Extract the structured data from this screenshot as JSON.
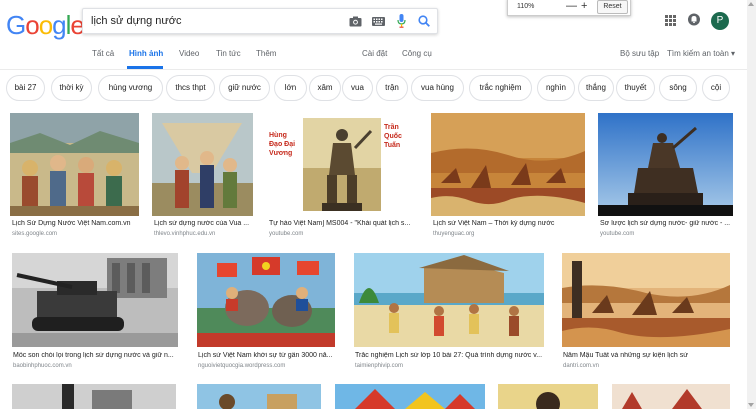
{
  "search": {
    "query": "lịch sử dựng nước"
  },
  "logo": {
    "letters": [
      "G",
      "o",
      "o",
      "g",
      "l",
      "e"
    ],
    "colors": [
      "#4285f4",
      "#ea4335",
      "#fbbc05",
      "#4285f4",
      "#34a853",
      "#ea4335"
    ]
  },
  "zoom": {
    "level": "110%",
    "minus": "—",
    "plus": "+",
    "reset": "Reset"
  },
  "account": {
    "initial": "P",
    "avatar_color": "#1c6a4e"
  },
  "tabs": {
    "all": "Tất cả",
    "images": "Hình ảnh",
    "videos": "Video",
    "news": "Tin tức",
    "more": "Thêm",
    "settings": "Cài đặt",
    "tools": "Công cụ",
    "collections": "Bộ sưu tập",
    "safe_search": "Tìm kiếm an toàn ▾"
  },
  "chips": [
    "bài 27",
    "thời kỳ",
    "hùng vương",
    "thcs thpt",
    "giữ nước",
    "lớn",
    "xâm",
    "vua",
    "trận",
    "vua hùng",
    "trắc nghiệm",
    "nghìn",
    "thắng",
    "thuyết",
    "sông",
    "cội"
  ],
  "results": [
    {
      "title": "Lịch Sử Dựng Nước Việt Nam.com.vn",
      "source": "sites.google.com"
    },
    {
      "title": "Lịch sử dựng nước của Vua ...",
      "source": "thlevo.vinhphuc.edu.vn"
    },
    {
      "title": "Tự hào Việt Nam] MS004 - \"Khái quát lịch s...",
      "source": "youtube.com",
      "poster_left": "Hùng Đạo Đại Vương",
      "poster_right": "Trần Quốc Tuấn"
    },
    {
      "title": "Lịch sử Việt Nam – Thời kỳ dựng nước",
      "source": "thuyenguac.org"
    },
    {
      "title": "Sơ lược lịch sử dựng nước- giữ nước - ...",
      "source": "youtube.com"
    },
    {
      "title": "Mốc son chói lọi trong lịch sử dựng nước và giữ n...",
      "source": "baobinhphuoc.com.vn"
    },
    {
      "title": "Lịch sử Việt Nam khởi sự từ gần 3000 nă...",
      "source": "nguoivietquocgia.wordpress.com"
    },
    {
      "title": "Trắc nghiệm Lịch sử lớp 10 bài 27: Quá trình dựng nước v...",
      "source": "taimienphivip.com"
    },
    {
      "title": "Năm Mậu Tuất và những sự kiện lịch sử",
      "source": "dantri.com.vn"
    }
  ]
}
